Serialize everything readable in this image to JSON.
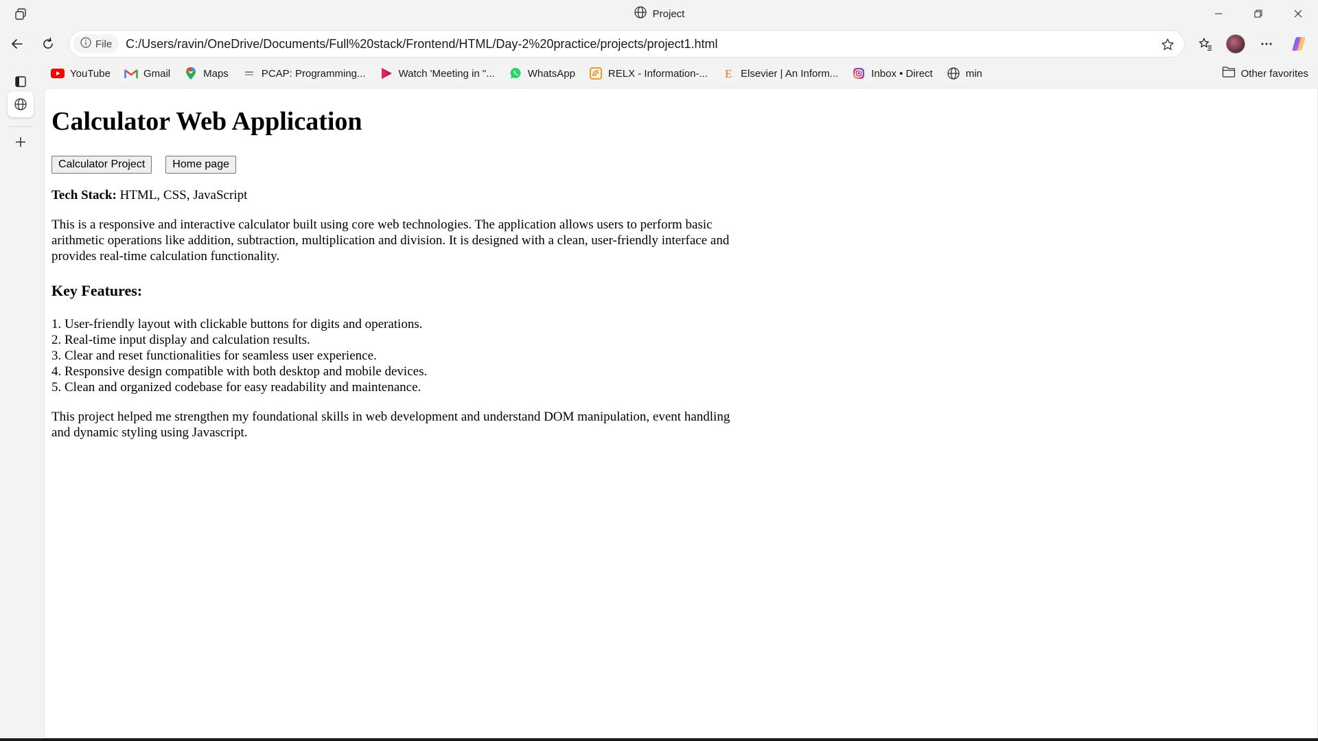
{
  "window": {
    "title": "Project"
  },
  "address_bar": {
    "site_label": "File",
    "url": "C:/Users/ravin/OneDrive/Documents/Full%20stack/Frontend/HTML/Day-2%20practice/projects/project1.html"
  },
  "bookmarks": [
    {
      "label": "YouTube",
      "icon": "youtube-icon"
    },
    {
      "label": "Gmail",
      "icon": "gmail-icon"
    },
    {
      "label": "Maps",
      "icon": "maps-icon"
    },
    {
      "label": "PCAP: Programming...",
      "icon": "pcap-icon"
    },
    {
      "label": "Watch 'Meeting in \"...",
      "icon": "play-icon"
    },
    {
      "label": "WhatsApp",
      "icon": "whatsapp-icon"
    },
    {
      "label": "RELX - Information-...",
      "icon": "relx-icon"
    },
    {
      "label": "Elsevier | An Inform...",
      "icon": "elsevier-icon"
    },
    {
      "label": "Inbox • Direct",
      "icon": "instagram-icon"
    },
    {
      "label": "min",
      "icon": "globe-icon"
    }
  ],
  "other_favorites": "Other favorites",
  "page": {
    "heading": "Calculator Web Application",
    "buttons": {
      "project": "Calculator Project",
      "home": "Home page"
    },
    "tech_stack_label": "Tech Stack:",
    "tech_stack_value": " HTML, CSS, JavaScript",
    "description": "This is a responsive and interactive calculator built using core web technologies. The application allows users to perform basic arithmetic operations like addition, subtraction, multiplication and division. It is designed with a clean, user-friendly interface and provides real-time calculation functionality.",
    "features_heading": "Key Features:",
    "features": [
      "1. User-friendly layout with clickable buttons for digits and operations.",
      "2. Real-time input display and calculation results.",
      "3. Clear and reset functionalities for seamless user experience.",
      "4. Responsive design compatible with both desktop and mobile devices.",
      "5. Clean and organized codebase for easy readability and maintenance."
    ],
    "closing": "This project helped me strengthen my foundational skills in web development and understand DOM manipulation, event handling and dynamic styling using Javascript."
  }
}
